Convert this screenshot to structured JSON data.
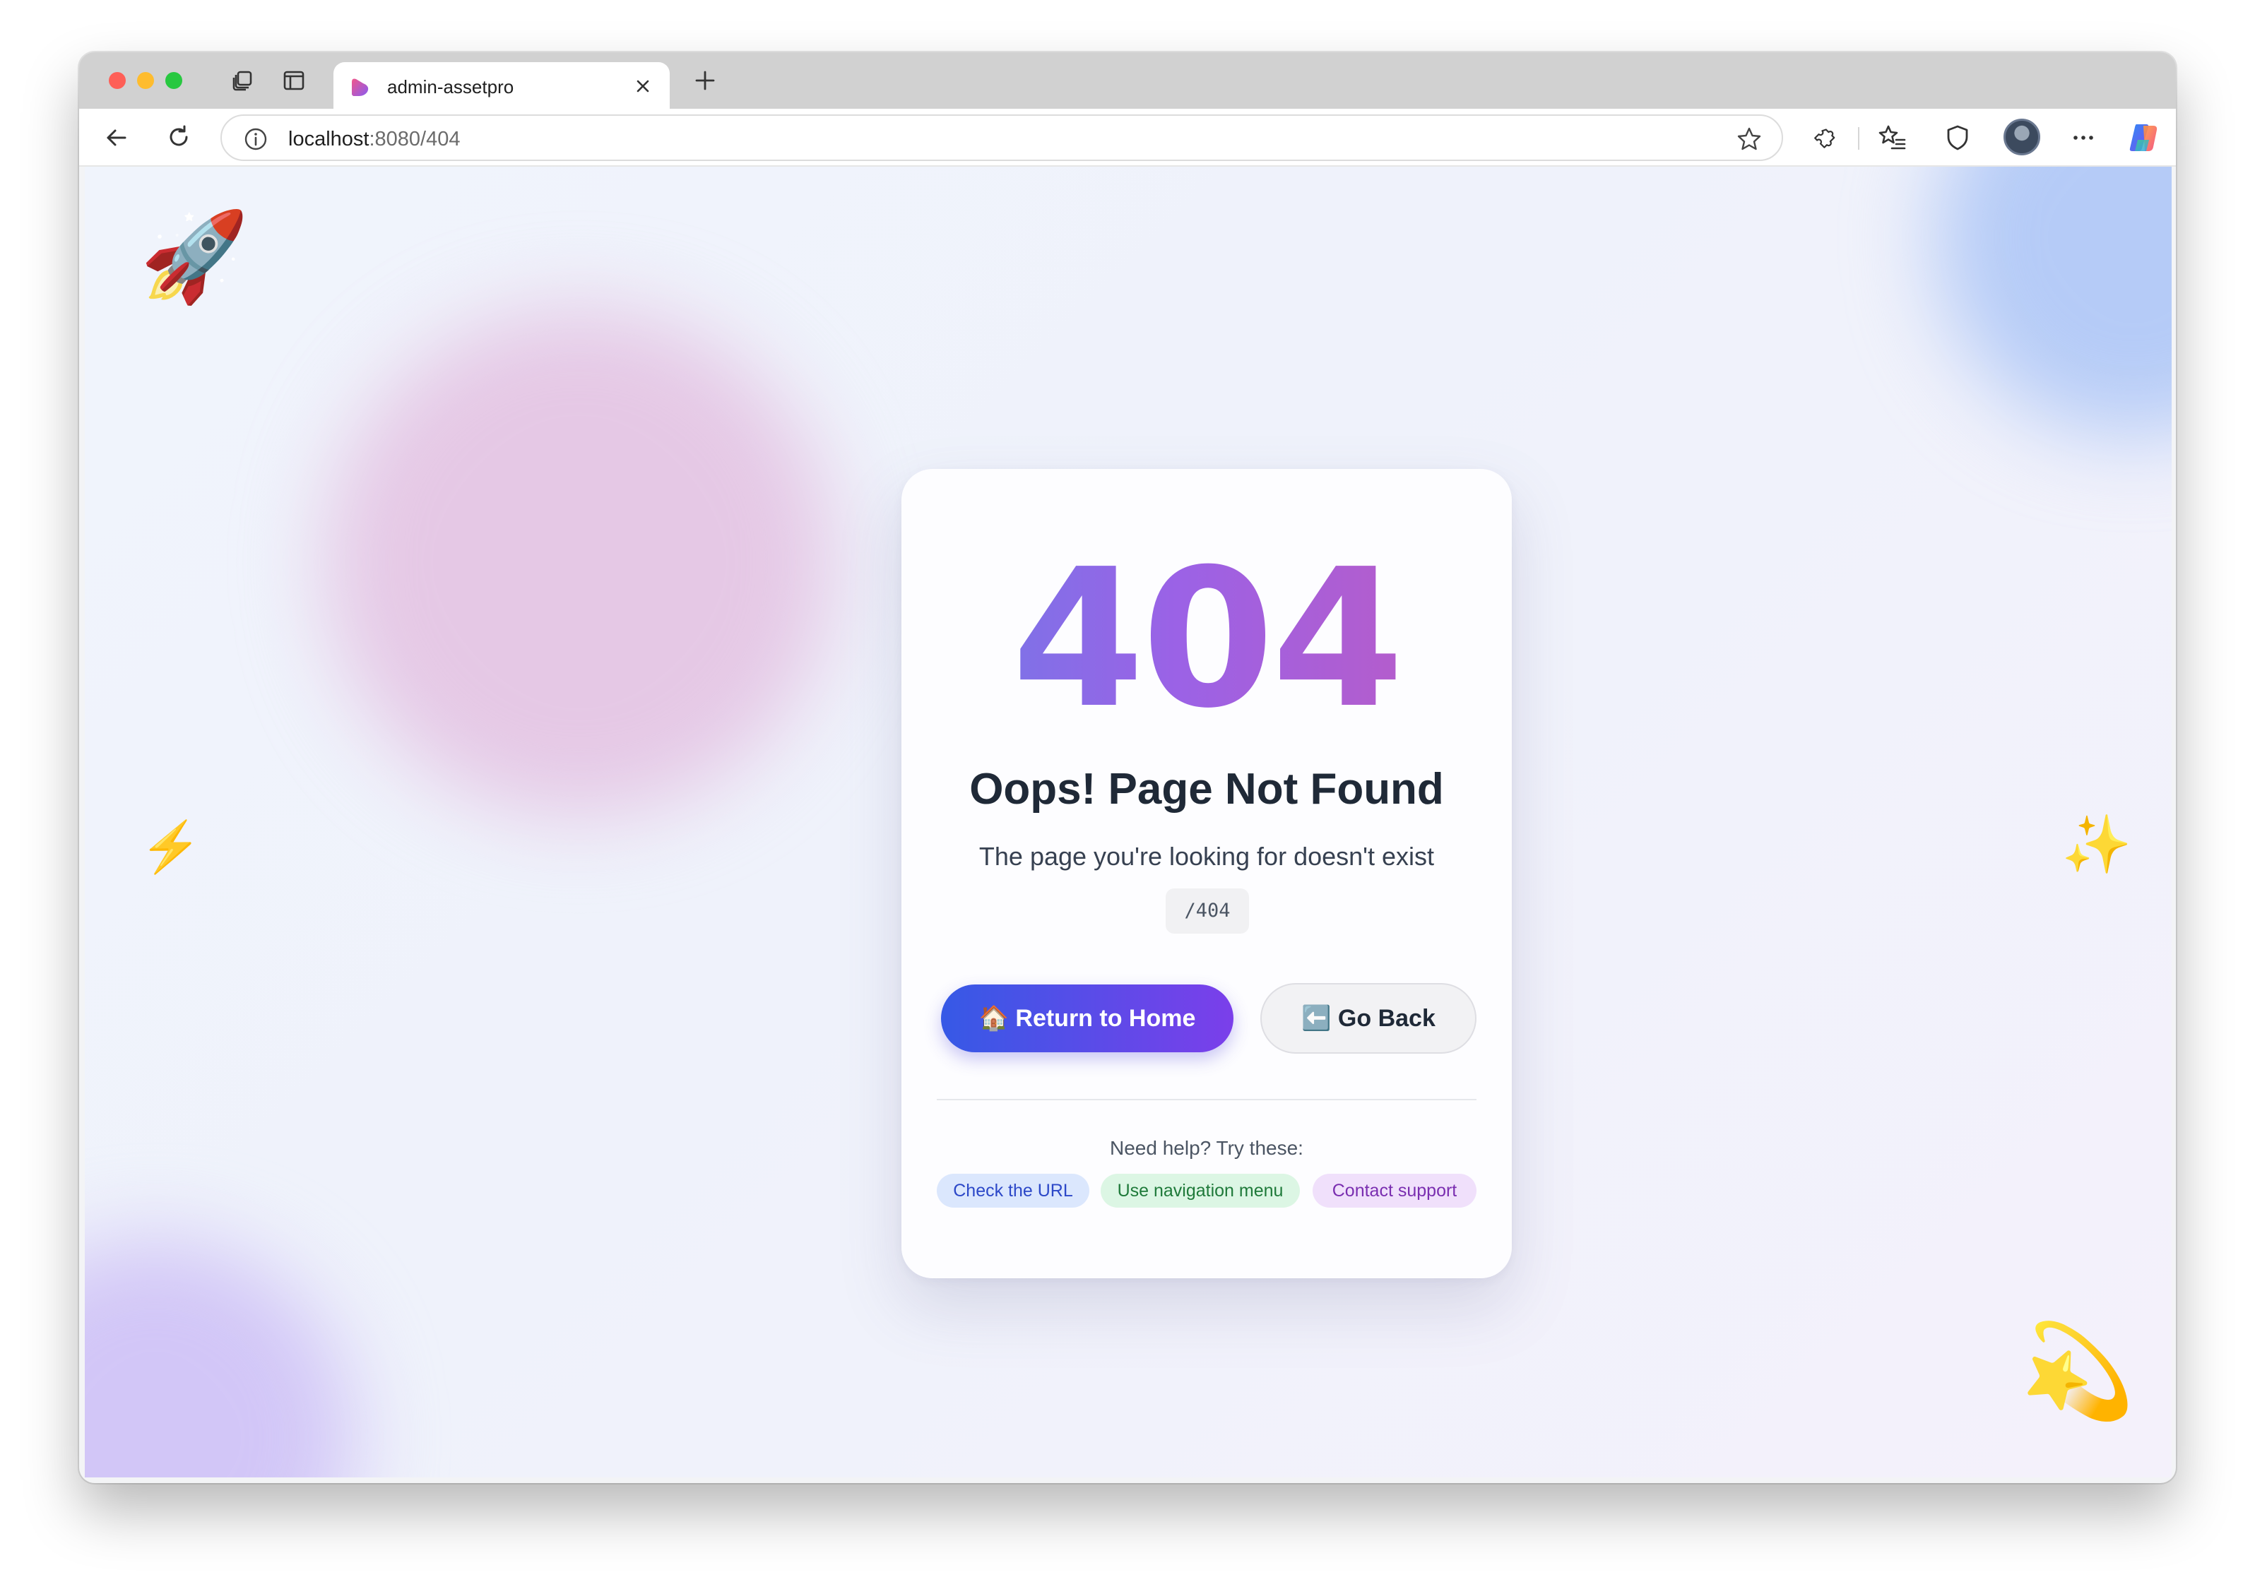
{
  "browser": {
    "tab_title": "admin-assetpro",
    "url_host": "localhost",
    "url_path": ":8080/404"
  },
  "page": {
    "error_code": "404",
    "title": "Oops! Page Not Found",
    "subtitle": "The page you're looking for doesn't exist",
    "path": "/404",
    "primary_button": "🏠 Return to Home",
    "secondary_button": "⬅️ Go Back",
    "help_text": "Need help? Try these:",
    "chips": [
      "Check the URL",
      "Use navigation menu",
      "Contact support"
    ],
    "decorations": {
      "rocket": "🚀",
      "bolt": "⚡",
      "sparkle": "✨",
      "dizzy": "💫"
    }
  },
  "colors": {
    "primary_gradient_start": "#3659e6",
    "primary_gradient_end": "#7b3fea",
    "code_gradient_start": "#6d7be8",
    "code_gradient_end": "#c05ac0"
  },
  "icons": {
    "tab_favicon": "assetpro-favicon-icon",
    "back": "arrow-left-icon",
    "reload": "reload-icon",
    "site_info": "info-icon",
    "bookmark": "star-icon",
    "extensions": "puzzle-icon",
    "favorites": "favorites-icon",
    "browser_essentials": "shield-icon",
    "profile": "avatar",
    "more": "more-icon",
    "copilot": "copilot-icon"
  }
}
